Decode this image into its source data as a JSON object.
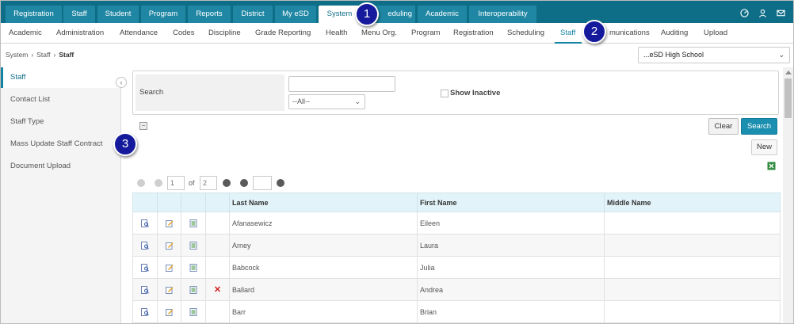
{
  "top_tabs": [
    {
      "label": "Registration"
    },
    {
      "label": "Staff"
    },
    {
      "label": "Student"
    },
    {
      "label": "Program"
    },
    {
      "label": "Reports"
    },
    {
      "label": "District"
    },
    {
      "label": "My eSD"
    },
    {
      "label": "System",
      "active": true
    },
    {
      "label": "eduling"
    },
    {
      "label": "Academic"
    },
    {
      "label": "Interoperability"
    }
  ],
  "top_icons": [
    "dashboard-icon",
    "user-icon",
    "mail-icon"
  ],
  "sub_nav": [
    {
      "label": "Academic"
    },
    {
      "label": "Administration"
    },
    {
      "label": "Attendance"
    },
    {
      "label": "Codes"
    },
    {
      "label": "Discipline"
    },
    {
      "label": "Grade Reporting"
    },
    {
      "label": "Health"
    },
    {
      "label": "Menu Org."
    },
    {
      "label": "Program"
    },
    {
      "label": "Registration"
    },
    {
      "label": "Scheduling"
    },
    {
      "label": "Staff",
      "active": true
    },
    {
      "label": "munications"
    },
    {
      "label": "Auditing"
    },
    {
      "label": "Upload"
    }
  ],
  "breadcrumb": [
    "System",
    "Staff",
    "Staff"
  ],
  "school_select": "...eSD High School",
  "sidebar": {
    "items": [
      {
        "label": "Staff",
        "active": true
      },
      {
        "label": "Contact List"
      },
      {
        "label": "Staff Type"
      },
      {
        "label": "Mass Update Staff Contract"
      },
      {
        "label": "Document Upload"
      }
    ]
  },
  "search": {
    "label": "Search",
    "value": "",
    "filter_value": "--All--",
    "show_inactive_label": "Show Inactive"
  },
  "buttons": {
    "clear": "Clear",
    "search": "Search",
    "new": "New"
  },
  "pager": {
    "page": "1",
    "of_label": "of",
    "total": "2",
    "goto": ""
  },
  "grid": {
    "columns": [
      "Last Name",
      "First Name",
      "Middle Name"
    ],
    "rows": [
      {
        "last": "Afanasewicz",
        "first": "Eileen",
        "middle": "",
        "deletable": false
      },
      {
        "last": "Arney",
        "first": "Laura",
        "middle": "",
        "deletable": false
      },
      {
        "last": "Babcock",
        "first": "Julia",
        "middle": "",
        "deletable": false
      },
      {
        "last": "Ballard",
        "first": "Andrea",
        "middle": "",
        "deletable": true
      },
      {
        "last": "Barr",
        "first": "Brian",
        "middle": "",
        "deletable": false
      }
    ]
  },
  "callouts": [
    "1",
    "2",
    "3"
  ],
  "colors": {
    "topbar": "#0e6e88",
    "accent": "#1583a2",
    "callout": "#151a9c"
  }
}
